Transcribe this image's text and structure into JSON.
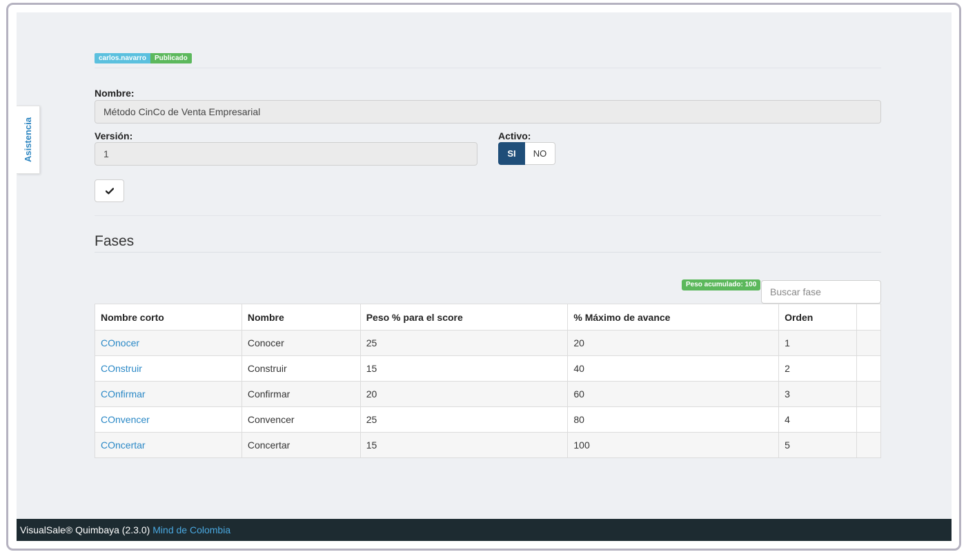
{
  "sidebar": {
    "asistencia_label": "Asistencia"
  },
  "badges": {
    "user": "carlos.navarro",
    "status": "Publicado"
  },
  "form": {
    "nombre_label": "Nombre:",
    "nombre_value": "Método CinCo de Venta Empresarial",
    "version_label": "Versión:",
    "version_value": "1",
    "activo_label": "Activo:",
    "activo_options": [
      "SI",
      "NO"
    ],
    "activo_selected": "SI"
  },
  "fases": {
    "title": "Fases",
    "peso_badge": "Peso acumulado: 100",
    "search_placeholder": "Buscar fase",
    "columns": [
      "Nombre corto",
      "Nombre",
      "Peso % para el score",
      "% Máximo de avance",
      "Orden",
      ""
    ],
    "rows": [
      {
        "short": "COnocer",
        "name": "Conocer",
        "peso": "25",
        "max": "20",
        "orden": "1"
      },
      {
        "short": "COnstruir",
        "name": "Construir",
        "peso": "15",
        "max": "40",
        "orden": "2"
      },
      {
        "short": "COnfirmar",
        "name": "Confirmar",
        "peso": "20",
        "max": "60",
        "orden": "3"
      },
      {
        "short": "COnvencer",
        "name": "Convencer",
        "peso": "25",
        "max": "80",
        "orden": "4"
      },
      {
        "short": "COncertar",
        "name": "Concertar",
        "peso": "15",
        "max": "100",
        "orden": "5"
      }
    ]
  },
  "footer": {
    "app": "VisualSale® Quimbaya (2.3.0)",
    "company": "Mind de Colombia"
  },
  "colors": {
    "accent": "#1f4e79",
    "link": "#2a88c6",
    "success": "#5cb85c",
    "info": "#5bc0de",
    "footer_bg": "#1d2b31"
  },
  "icons": {
    "save": "check-icon"
  }
}
